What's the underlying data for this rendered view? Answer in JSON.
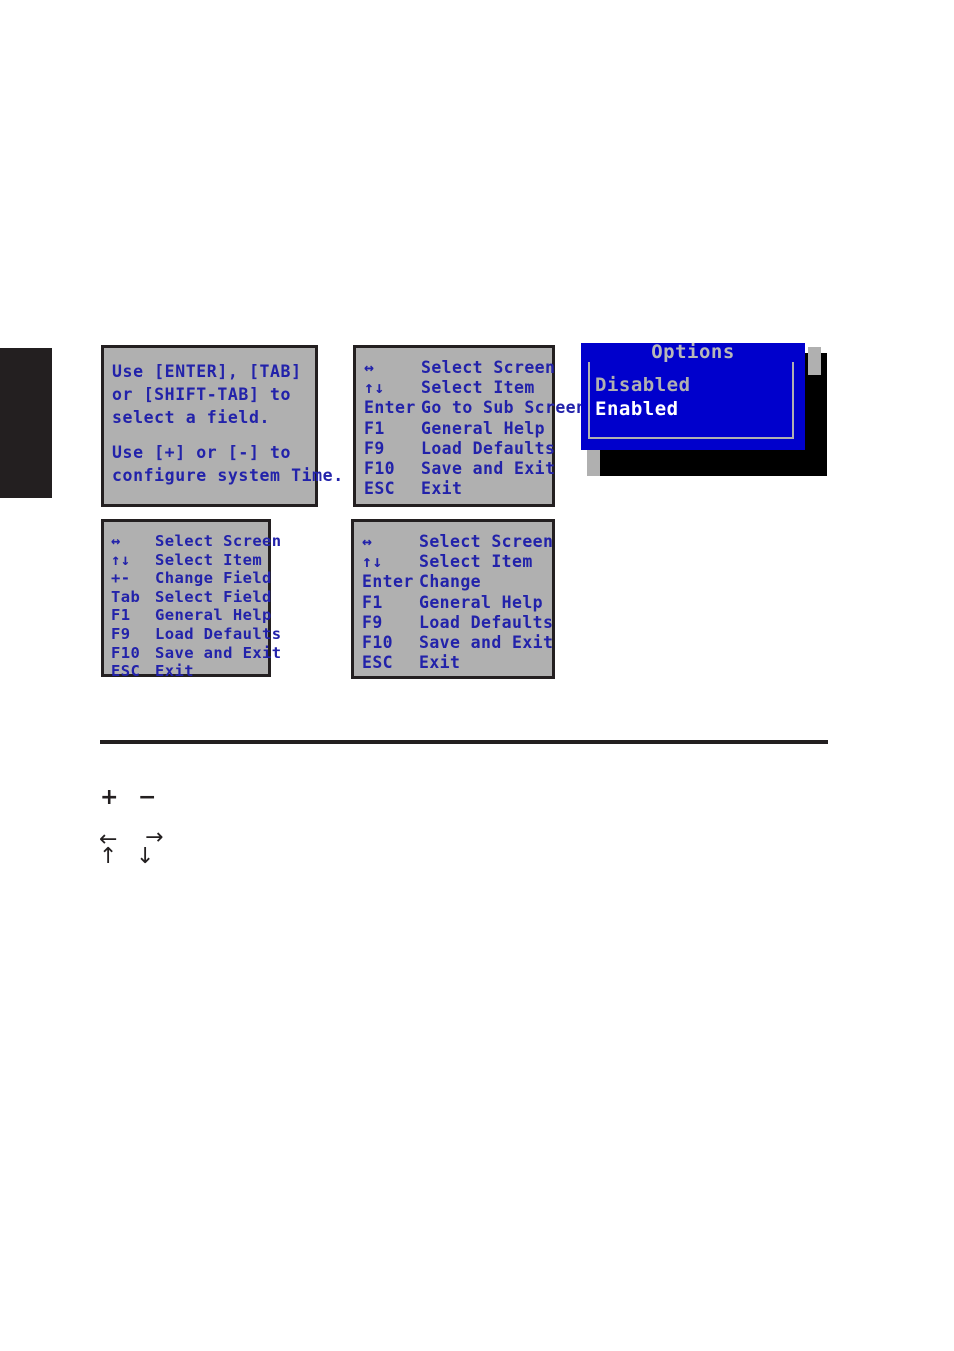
{
  "page": {
    "background_color": "#ffffff",
    "bios_panel_bg": "#b0b0b0",
    "bios_text_color": "#2222aa",
    "popup_bg": "#0000cc",
    "ink_color": "#231f20"
  },
  "edge_tab": {
    "label": ""
  },
  "help_panel": {
    "lines": [
      "Use [ENTER], [TAB]",
      "or [SHIFT-TAB] to",
      "select a field.",
      "Use [+] or [-] to",
      "configure system Time."
    ]
  },
  "keys_sub_panel": {
    "rows": [
      {
        "key": "↔",
        "desc": "Select Screen"
      },
      {
        "key": "↑↓",
        "desc": "Select Item"
      },
      {
        "key": "Enter",
        "desc": "Go to Sub Screen"
      },
      {
        "key": "F1",
        "desc": "General Help"
      },
      {
        "key": "F9",
        "desc": "Load Defaults"
      },
      {
        "key": "F10",
        "desc": "Save and Exit"
      },
      {
        "key": "ESC",
        "desc": "Exit"
      }
    ]
  },
  "keys_field_panel": {
    "rows": [
      {
        "key": "↔",
        "desc": "Select Screen"
      },
      {
        "key": "↑↓",
        "desc": "Select Item"
      },
      {
        "key": "+-",
        "desc": "Change Field"
      },
      {
        "key": "Tab",
        "desc": "Select Field"
      },
      {
        "key": "F1",
        "desc": "General Help"
      },
      {
        "key": "F9",
        "desc": "Load Defaults"
      },
      {
        "key": "F10",
        "desc": "Save and Exit"
      },
      {
        "key": "ESC",
        "desc": "Exit"
      }
    ]
  },
  "keys_change_panel": {
    "rows": [
      {
        "key": "↔",
        "desc": "Select Screen"
      },
      {
        "key": "↑↓",
        "desc": "Select Item"
      },
      {
        "key": "Enter",
        "desc": "Change"
      },
      {
        "key": "F1",
        "desc": "General Help"
      },
      {
        "key": "F9",
        "desc": "Load Defaults"
      },
      {
        "key": "F10",
        "desc": "Save and Exit"
      },
      {
        "key": "ESC",
        "desc": "Exit"
      }
    ]
  },
  "options_popup": {
    "title": "Options",
    "items": [
      {
        "label": "Disabled",
        "selected": false,
        "color": "#b0b0b0"
      },
      {
        "label": "Enabled",
        "selected": true,
        "color": "#ffffff"
      }
    ]
  },
  "glyph_legend": {
    "plus": "+",
    "minus": "−",
    "left": "←",
    "right": "→",
    "up": "↑",
    "down": "↓"
  }
}
